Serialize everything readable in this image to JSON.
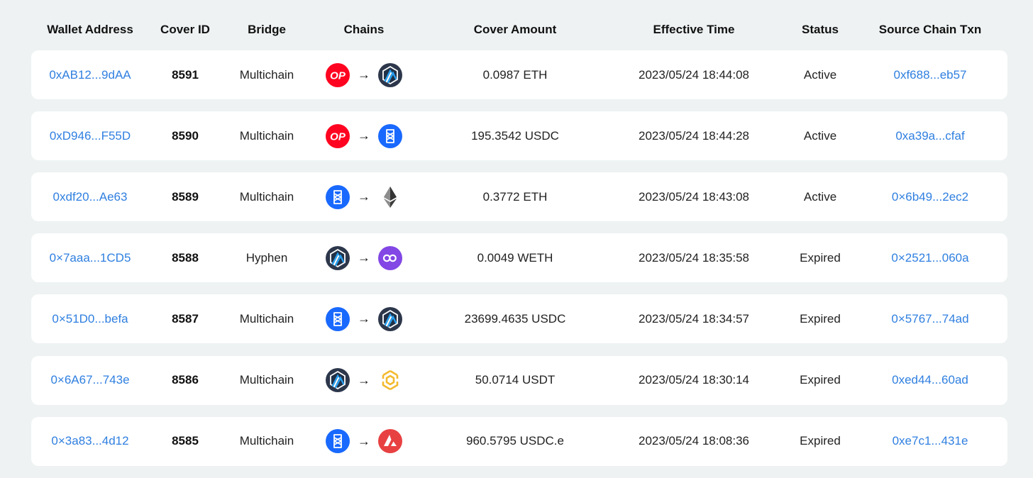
{
  "columns": [
    "Wallet Address",
    "Cover ID",
    "Bridge",
    "Chains",
    "Cover Amount",
    "Effective Time",
    "Status",
    "Source Chain Txn"
  ],
  "rows": [
    {
      "wallet": "0xAB12...9dAA",
      "cover_id": "8591",
      "bridge": "Multichain",
      "from_chain": "optimism",
      "to_chain": "arbitrum",
      "amount": "0.0987 ETH",
      "time": "2023/05/24 18:44:08",
      "status": "Active",
      "txn": "0xf688...eb57"
    },
    {
      "wallet": "0xD946...F55D",
      "cover_id": "8590",
      "bridge": "Multichain",
      "from_chain": "optimism",
      "to_chain": "fantom",
      "amount": "195.3542 USDC",
      "time": "2023/05/24 18:44:28",
      "status": "Active",
      "txn": "0xa39a...cfaf"
    },
    {
      "wallet": "0xdf20...Ae63",
      "cover_id": "8589",
      "bridge": "Multichain",
      "from_chain": "fantom",
      "to_chain": "ethereum",
      "amount": "0.3772 ETH",
      "time": "2023/05/24 18:43:08",
      "status": "Active",
      "txn": "0×6b49...2ec2"
    },
    {
      "wallet": "0×7aaa...1CD5",
      "cover_id": "8588",
      "bridge": "Hyphen",
      "from_chain": "arbitrum",
      "to_chain": "polygon",
      "amount": "0.0049 WETH",
      "time": "2023/05/24 18:35:58",
      "status": "Expired",
      "txn": "0×2521...060a"
    },
    {
      "wallet": "0×51D0...befa",
      "cover_id": "8587",
      "bridge": "Multichain",
      "from_chain": "fantom",
      "to_chain": "arbitrum",
      "amount": "23699.4635 USDC",
      "time": "2023/05/24 18:34:57",
      "status": "Expired",
      "txn": "0×5767...74ad"
    },
    {
      "wallet": "0×6A67...743e",
      "cover_id": "8586",
      "bridge": "Multichain",
      "from_chain": "arbitrum",
      "to_chain": "bnb",
      "amount": "50.0714 USDT",
      "time": "2023/05/24 18:30:14",
      "status": "Expired",
      "txn": "0xed44...60ad"
    },
    {
      "wallet": "0×3a83...4d12",
      "cover_id": "8585",
      "bridge": "Multichain",
      "from_chain": "fantom",
      "to_chain": "avalanche",
      "amount": "960.5795 USDC.e",
      "time": "2023/05/24 18:08:36",
      "status": "Expired",
      "txn": "0xe7c1...431e"
    }
  ],
  "arrow_glyph": "→",
  "op_label": "OP",
  "colors": {
    "link": "#2f7fe0",
    "optimism": "#ff0420",
    "fantom": "#1969ff",
    "arbitrum": "#2d374b",
    "polygon": "#8247e5",
    "bnb": "#f3ba2f",
    "avalanche": "#e84142",
    "ethereum": "#343434"
  }
}
